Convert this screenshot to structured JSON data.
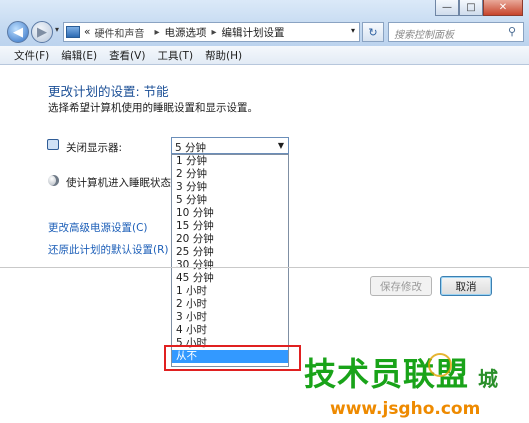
{
  "window": {
    "minimize": "—",
    "maximize": "□",
    "close": "✕"
  },
  "nav": {
    "back_icon": "◀",
    "forward_icon": "▶",
    "dropdown_icon": "▾"
  },
  "address": {
    "prefix": "«",
    "crumbs": [
      "硬件和声音",
      "电源选项",
      "编辑计划设置"
    ],
    "separator": "▸",
    "dropdown_icon": "▾"
  },
  "refresh_icon": "↻",
  "search": {
    "placeholder": "搜索控制面板",
    "icon": "search-icon"
  },
  "menu": [
    "文件(F)",
    "编辑(E)",
    "查看(V)",
    "工具(T)",
    "帮助(H)"
  ],
  "page": {
    "heading": "更改计划的设置: 节能",
    "subtitle": "选择希望计算机使用的睡眠设置和显示设置。",
    "display_label": "关闭显示器:",
    "sleep_label": "使计算机进入睡眠状态:",
    "selected_value": "5 分钟",
    "select_arrow": "▼",
    "options": [
      "1 分钟",
      "2 分钟",
      "3 分钟",
      "5 分钟",
      "10 分钟",
      "15 分钟",
      "20 分钟",
      "25 分钟",
      "30 分钟",
      "45 分钟",
      "1 小时",
      "2 小时",
      "3 小时",
      "4 小时",
      "5 小时",
      "从不"
    ],
    "highlighted_option_index": 15,
    "link_advanced": "更改高级电源设置(C)",
    "link_restore": "还原此计划的默认设置(R)",
    "save_button": "保存修改",
    "cancel_button": "取消"
  },
  "watermark": {
    "title": "技术员联盟",
    "city": "城",
    "url": "www.jsgho.com"
  },
  "colors": {
    "heading": "#1b4f96",
    "link": "#1d5fb8",
    "selection": "#3399ff",
    "highlight_box": "#e02020",
    "watermark_green": "#19a319",
    "watermark_orange": "#ee8a00"
  }
}
